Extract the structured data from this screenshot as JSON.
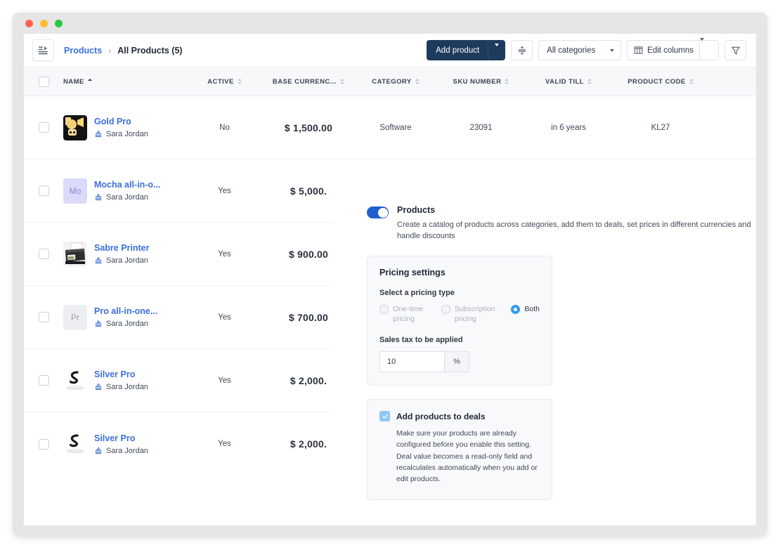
{
  "toolbar": {
    "panel_icon": "list-panel-icon",
    "breadcrumb_root": "Products",
    "breadcrumb_sep": "›",
    "breadcrumb_current": "All Products (5)",
    "add_product_label": "Add product",
    "density_icon": "row-density-icon",
    "category_filter_value": "All categories",
    "edit_columns_label": "Edit columns",
    "filter_icon": "funnel-filter-icon"
  },
  "table": {
    "columns": [
      {
        "key": "name",
        "label": "NAME",
        "sorted": true
      },
      {
        "key": "active",
        "label": "ACTIVE",
        "sorted": false
      },
      {
        "key": "base",
        "label": "BASE CURRENC...",
        "sorted": false
      },
      {
        "key": "category",
        "label": "CATEGORY",
        "sorted": false
      },
      {
        "key": "sku",
        "label": "SKU NUMBER",
        "sorted": false
      },
      {
        "key": "valid",
        "label": "VALID TILL",
        "sorted": false
      },
      {
        "key": "code",
        "label": "PRODUCT CODE",
        "sorted": false
      }
    ],
    "rows": [
      {
        "name": "Gold Pro",
        "owner": "Sara Jordan",
        "active": "No",
        "base": "$ 1,500.00",
        "category": "Software",
        "sku": "23091",
        "valid": "in 6 years",
        "code": "KL27",
        "thumb_type": "image-gold",
        "thumb_label": ""
      },
      {
        "name": "Mocha all-in-o...",
        "owner": "Sara Jordan",
        "active": "Yes",
        "base": "$ 5,000.",
        "category": "",
        "sku": "",
        "valid": "",
        "code": "",
        "thumb_type": "avatar-purple",
        "thumb_label": "Mo"
      },
      {
        "name": "Sabre Printer",
        "owner": "Sara Jordan",
        "active": "Yes",
        "base": "$ 900.00",
        "category": "",
        "sku": "",
        "valid": "",
        "code": "",
        "thumb_type": "image-printer",
        "thumb_label": ""
      },
      {
        "name": "Pro all-in-one...",
        "owner": "Sara Jordan",
        "active": "Yes",
        "base": "$ 700.00",
        "category": "",
        "sku": "",
        "valid": "",
        "code": "",
        "thumb_type": "avatar-gray",
        "thumb_label": "Pr"
      },
      {
        "name": "Silver Pro",
        "owner": "Sara Jordan",
        "active": "Yes",
        "base": "$ 2,000.",
        "category": "",
        "sku": "",
        "valid": "",
        "code": "",
        "thumb_type": "image-silver",
        "thumb_label": ""
      },
      {
        "name": "Silver Pro",
        "owner": "Sara Jordan",
        "active": "Yes",
        "base": "$ 2,000.",
        "category": "",
        "sku": "",
        "valid": "",
        "code": "",
        "thumb_type": "image-silver",
        "thumb_label": ""
      }
    ]
  },
  "settings": {
    "toggle_on": true,
    "title": "Products",
    "subtitle": "Create a catalog of products across categories, add them to deals, set prices in different currencies and handle discounts",
    "pricing": {
      "card_title": "Pricing settings",
      "type_label": "Select a pricing type",
      "options": [
        {
          "label": "One-time pricing",
          "selected": false,
          "disabled": true
        },
        {
          "label": "Subscription pricing",
          "selected": false,
          "disabled": true
        },
        {
          "label": "Both",
          "selected": true,
          "disabled": false
        }
      ],
      "tax_label": "Sales tax to be applied",
      "tax_value": "10",
      "tax_unit": "%"
    },
    "deals": {
      "checked": true,
      "title": "Add products to deals",
      "description": "Make sure your products are already configured before you enable this setting. Deal value becomes a read-only field and recalculates automatically when you add or edit products."
    }
  },
  "colors": {
    "accent_blue": "#3a6fe0",
    "primary_dark": "#1e3a5c",
    "toggle_blue": "#1f5fd0",
    "radio_blue": "#2f9af7",
    "checkbox_blue": "#8ec6f7"
  }
}
